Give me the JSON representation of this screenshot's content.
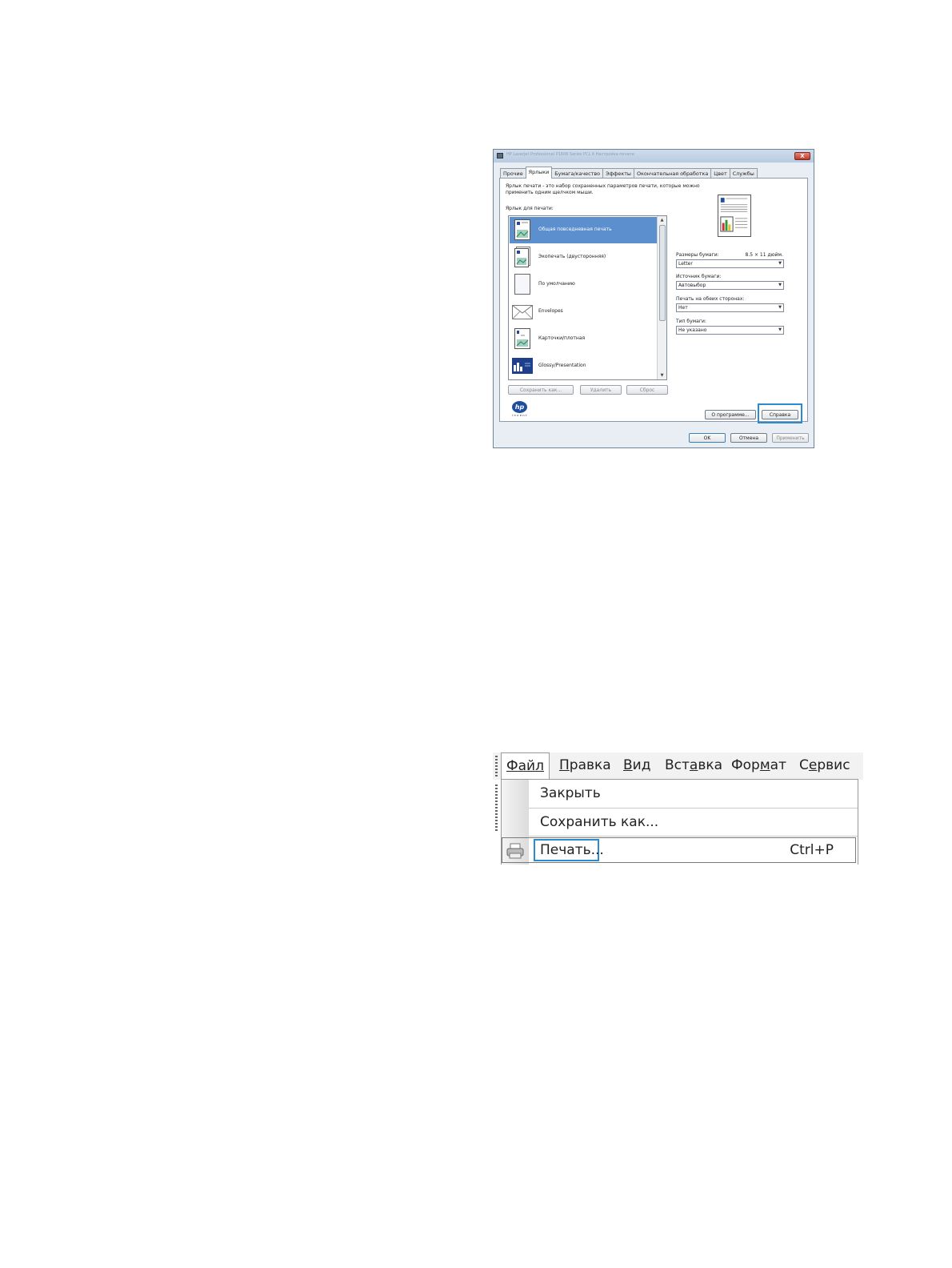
{
  "dialog": {
    "title": "HP LaserJet Professional P1606 Series PCL 6 Настройка печати",
    "close_label": "X",
    "tabs": [
      {
        "label": "Прочие"
      },
      {
        "label": "Ярлыки"
      },
      {
        "label": "Бумага/качество"
      },
      {
        "label": "Эффекты"
      },
      {
        "label": "Окончательная обработка"
      },
      {
        "label": "Цвет"
      },
      {
        "label": "Службы"
      }
    ],
    "active_tab": "Ярлыки",
    "description": "Ярлык печати - это набор сохраненных параметров печати, которые можно применить одним щелчком мыши.",
    "shortcuts_label": "Ярлык для печати:",
    "shortcuts": [
      {
        "label": "Общая повседневная печать",
        "selected": true
      },
      {
        "label": "Экопечать (двусторонняя)",
        "selected": false
      },
      {
        "label": "По умолчанию",
        "selected": false
      },
      {
        "label": "Envelopes",
        "selected": false
      },
      {
        "label": "Карточки/плотная",
        "selected": false
      },
      {
        "label": "Glossy/Presentation",
        "selected": false
      }
    ],
    "buttons": {
      "save_as": "Сохранить как...",
      "delete": "Удалить",
      "reset": "Сброс",
      "about": "О программе...",
      "help": "Справка",
      "ok": "OK",
      "cancel": "Отмена",
      "apply": "Применить"
    },
    "fields": {
      "paper_size_label": "Размеры бумаги:",
      "paper_size_dims": "8.5 × 11 дюйм.",
      "paper_size_value": "Letter",
      "paper_source_label": "Источник бумаги:",
      "paper_source_value": "Автовыбор",
      "duplex_label": "Печать на обеих сторонах:",
      "duplex_value": "Нет",
      "paper_type_label": "Тип бумаги:",
      "paper_type_value": "Не указано"
    },
    "logo": {
      "text": "hp",
      "subtext": "invent"
    }
  },
  "menu": {
    "menubar": [
      {
        "label": "Файл",
        "hotkey_index": 0
      },
      {
        "label": "Правка",
        "hotkey_index": 0
      },
      {
        "label": "Вид",
        "hotkey_index": 0
      },
      {
        "label": "Вставка",
        "hotkey_index": 3
      },
      {
        "label": "Формат",
        "hotkey_index": 3
      },
      {
        "label": "Сервис",
        "hotkey_index": 1
      }
    ],
    "items": [
      {
        "label": "Закрыть"
      },
      {
        "label": "Сохранить как..."
      },
      {
        "label": "Печать...",
        "shortcut": "Ctrl+P"
      }
    ]
  },
  "colors": {
    "selection": "#5b8fcd",
    "highlight": "#2a8bd0",
    "hp_blue": "#1d4d9c"
  }
}
